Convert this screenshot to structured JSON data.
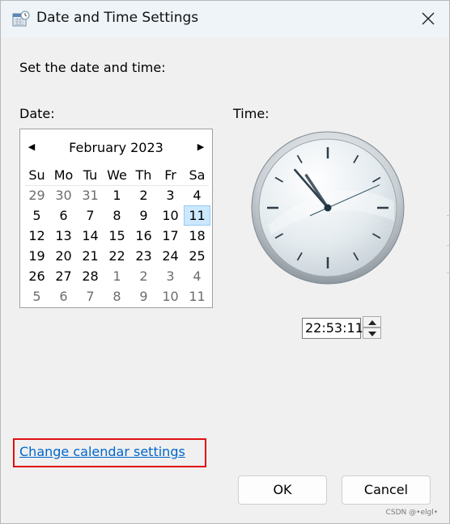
{
  "window": {
    "title": "Date and Time Settings",
    "icon": "calendar-clock-icon",
    "close_icon": "close-icon"
  },
  "main": {
    "heading": "Set the date and time:",
    "date_label": "Date:",
    "time_label": "Time:"
  },
  "calendar": {
    "month_title": "February 2023",
    "prev_icon": "triangle-left-icon",
    "next_icon": "triangle-right-icon",
    "weekdays": [
      "Su",
      "Mo",
      "Tu",
      "We",
      "Th",
      "Fr",
      "Sa"
    ],
    "selected_day": "11",
    "weeks": [
      [
        {
          "d": "29",
          "other": true
        },
        {
          "d": "30",
          "other": true
        },
        {
          "d": "31",
          "other": true
        },
        {
          "d": "1"
        },
        {
          "d": "2"
        },
        {
          "d": "3"
        },
        {
          "d": "4"
        }
      ],
      [
        {
          "d": "5"
        },
        {
          "d": "6"
        },
        {
          "d": "7"
        },
        {
          "d": "8"
        },
        {
          "d": "9"
        },
        {
          "d": "10"
        },
        {
          "d": "11",
          "selected": true
        }
      ],
      [
        {
          "d": "12"
        },
        {
          "d": "13"
        },
        {
          "d": "14"
        },
        {
          "d": "15"
        },
        {
          "d": "16"
        },
        {
          "d": "17"
        },
        {
          "d": "18"
        }
      ],
      [
        {
          "d": "19"
        },
        {
          "d": "20"
        },
        {
          "d": "21"
        },
        {
          "d": "22"
        },
        {
          "d": "23"
        },
        {
          "d": "24"
        },
        {
          "d": "25"
        }
      ],
      [
        {
          "d": "26"
        },
        {
          "d": "27"
        },
        {
          "d": "28"
        },
        {
          "d": "1",
          "other": true
        },
        {
          "d": "2",
          "other": true
        },
        {
          "d": "3",
          "other": true
        },
        {
          "d": "4",
          "other": true
        }
      ],
      [
        {
          "d": "5",
          "other": true
        },
        {
          "d": "6",
          "other": true
        },
        {
          "d": "7",
          "other": true
        },
        {
          "d": "8",
          "other": true
        },
        {
          "d": "9",
          "other": true
        },
        {
          "d": "10",
          "other": true
        },
        {
          "d": "11",
          "other": true
        }
      ]
    ]
  },
  "clock": {
    "hours": 22,
    "minutes": 53,
    "seconds": 11
  },
  "time": {
    "value": "22:53:11",
    "up_icon": "spin-up-icon",
    "down_icon": "spin-down-icon"
  },
  "link": {
    "label": "Change calendar settings"
  },
  "buttons": {
    "ok": "OK",
    "cancel": "Cancel"
  },
  "watermark": "CSDN @•elgl•",
  "colors": {
    "link": "#0066cc",
    "highlight_box": "#e11010",
    "selected_day_bg": "#cce8ff",
    "clock_hand_second": "#2d4d60"
  }
}
